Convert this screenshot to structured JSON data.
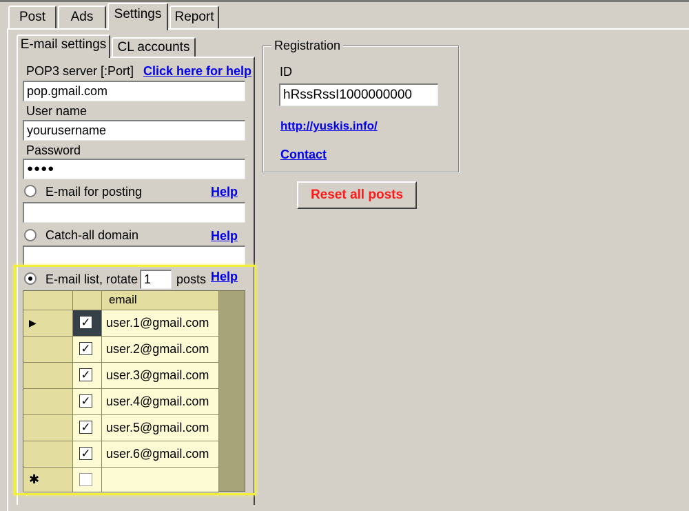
{
  "main_tabs": [
    {
      "label": "Post",
      "active": false
    },
    {
      "label": "Ads",
      "active": false
    },
    {
      "label": "Settings",
      "active": true
    },
    {
      "label": "Report",
      "active": false
    }
  ],
  "inner_tabs": [
    {
      "label": "E-mail settings",
      "active": true
    },
    {
      "label": "CL accounts",
      "active": false
    }
  ],
  "email_settings": {
    "pop3_label": "POP3 server [:Port]",
    "pop3_help": "Click here for help",
    "pop3_value": "pop.gmail.com",
    "username_label": "User name",
    "username_value": "yourusername",
    "password_label": "Password",
    "password_value": "●●●●",
    "email_posting_label": "E-mail for posting",
    "email_posting_help": "Help",
    "email_posting_value": "",
    "catchall_label": "Catch-all domain",
    "catchall_help": "Help",
    "catchall_value": "",
    "emaillist_label": "E-mail list, rotate",
    "rotate_value": "1",
    "posts_label": "posts",
    "emaillist_help": "Help",
    "selected_mode": "email_list"
  },
  "email_grid": {
    "column_header": "email",
    "rows": [
      {
        "email": "user.1@gmail.com",
        "checked": true
      },
      {
        "email": "user.2@gmail.com",
        "checked": true
      },
      {
        "email": "user.3@gmail.com",
        "checked": true
      },
      {
        "email": "user.4@gmail.com",
        "checked": true
      },
      {
        "email": "user.5@gmail.com",
        "checked": true
      },
      {
        "email": "user.6@gmail.com",
        "checked": true
      }
    ],
    "current_row_marker": "▶",
    "new_row_marker": "✱",
    "check_mark": "✓"
  },
  "registration": {
    "title": "Registration",
    "id_label": "ID",
    "id_value": "hRssRssI1000000000",
    "website_link": "http://yuskis.info/",
    "contact_link": "Contact"
  },
  "reset_button": "Reset all posts",
  "colors": {
    "highlight": "#f2ee3a",
    "reset_text": "#ff1a1a",
    "link": "#0000ee",
    "grid_header": "#e3dd9f",
    "grid_cell": "#fdfbd3"
  }
}
